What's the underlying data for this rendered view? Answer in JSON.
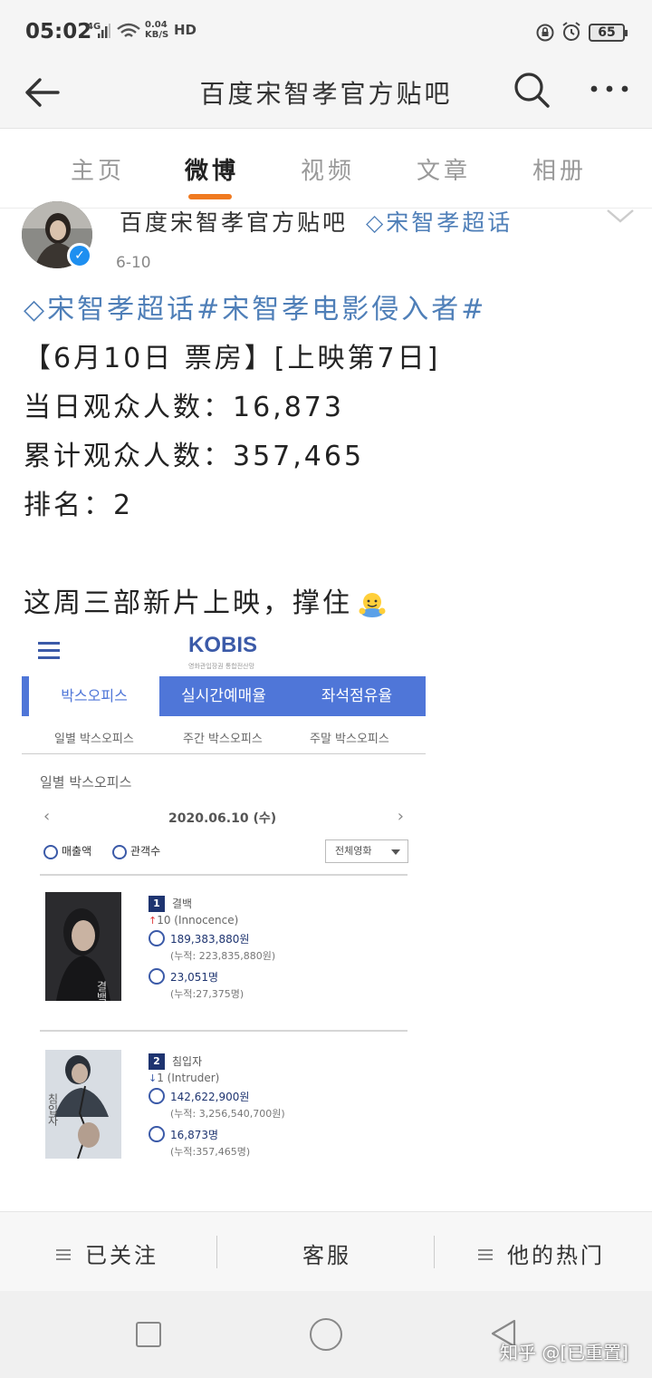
{
  "status_bar": {
    "time": "05:02",
    "network": "4G",
    "speed_value": "0.04",
    "speed_unit": "KB/S",
    "hd": "HD",
    "battery": "65"
  },
  "nav": {
    "title": "百度宋智孝官方贴吧"
  },
  "tabs": [
    {
      "label": "主页"
    },
    {
      "label": "微博"
    },
    {
      "label": "视频"
    },
    {
      "label": "文章"
    },
    {
      "label": "相册"
    }
  ],
  "post": {
    "author": "百度宋智孝官方贴吧",
    "author_tag": "◇宋智孝超话",
    "date": "6-10",
    "lines": [
      "◇宋智孝超话#宋智孝电影侵入者#",
      "【6月10日 票房】[上映第7日]",
      "当日观众人数：16,873",
      "累计观众人数：357,465",
      "排名：2",
      "这周三部新片上映，撑住"
    ]
  },
  "kobis": {
    "logo": "KOBIS",
    "logo_sub": "영화관입장권 통합전산망",
    "tabs": [
      "박스오피스",
      "실시간예매율",
      "좌석점유율"
    ],
    "subtabs": [
      "일별 박스오피스",
      "주간 박스오피스",
      "주말 박스오피스"
    ],
    "section_title": "일별 박스오피스",
    "date": "2020.06.10 (수)",
    "filter_sales": "매출액",
    "filter_audience": "관객수",
    "select_value": "전체영화",
    "movies": [
      {
        "rank": "1",
        "title": "결백",
        "change_arrow": "↑",
        "change": "10 (Innocence)",
        "sales": "189,383,880원",
        "sales_cum": "(누적: 223,835,880원)",
        "audience": "23,051명",
        "audience_cum": "(누적:27,375명)",
        "poster_text": "결백"
      },
      {
        "rank": "2",
        "title": "침입자",
        "change_arrow": "↓",
        "change": "1 (Intruder)",
        "sales": "142,622,900원",
        "sales_cum": "(누적: 3,256,540,700원)",
        "audience": "16,873명",
        "audience_cum": "(누적:357,465명)",
        "poster_text": "침입자"
      }
    ]
  },
  "toolbar": {
    "follow": "已关注",
    "service": "客服",
    "hot": "他的热门"
  },
  "watermark": "知乎 @[已重置]",
  "colors": {
    "accent_orange": "#f07a20",
    "link_blue": "#4f7fb8",
    "kobis_blue": "#4f76d8",
    "verified_blue": "#1e8ff0"
  }
}
